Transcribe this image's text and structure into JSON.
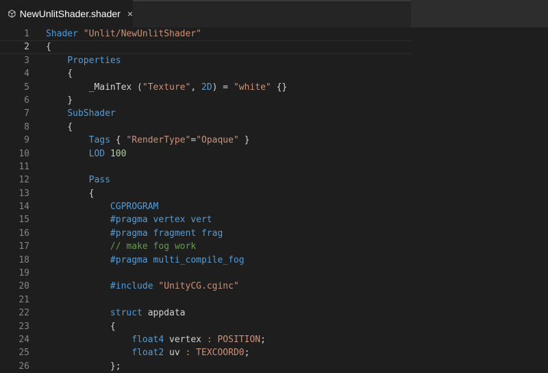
{
  "tab": {
    "title": "NewUnlitShader.shader",
    "close": "×",
    "icon": "unity-icon"
  },
  "editor": {
    "active_line": 2,
    "lines": [
      {
        "n": "1",
        "t": [
          {
            "c": "kw",
            "s": "Shader "
          },
          {
            "c": "str",
            "s": "\"Unlit/NewUnlitShader\""
          }
        ]
      },
      {
        "n": "2",
        "t": [
          {
            "c": "pl",
            "s": "{"
          }
        ]
      },
      {
        "n": "3",
        "t": [
          {
            "c": "pl",
            "s": "    "
          },
          {
            "c": "kw",
            "s": "Properties"
          }
        ]
      },
      {
        "n": "4",
        "t": [
          {
            "c": "pl",
            "s": "    {"
          }
        ]
      },
      {
        "n": "5",
        "t": [
          {
            "c": "pl",
            "s": "        _MainTex ("
          },
          {
            "c": "str",
            "s": "\"Texture\""
          },
          {
            "c": "pl",
            "s": ", "
          },
          {
            "c": "kw",
            "s": "2D"
          },
          {
            "c": "pl",
            "s": ") = "
          },
          {
            "c": "str",
            "s": "\"white\""
          },
          {
            "c": "pl",
            "s": " {}"
          }
        ]
      },
      {
        "n": "6",
        "t": [
          {
            "c": "pl",
            "s": "    }"
          }
        ]
      },
      {
        "n": "7",
        "t": [
          {
            "c": "pl",
            "s": "    "
          },
          {
            "c": "kw",
            "s": "SubShader"
          }
        ]
      },
      {
        "n": "8",
        "t": [
          {
            "c": "pl",
            "s": "    {"
          }
        ]
      },
      {
        "n": "9",
        "t": [
          {
            "c": "pl",
            "s": "        "
          },
          {
            "c": "kw",
            "s": "Tags"
          },
          {
            "c": "pl",
            "s": " { "
          },
          {
            "c": "str",
            "s": "\"RenderType\""
          },
          {
            "c": "pl",
            "s": "="
          },
          {
            "c": "str",
            "s": "\"Opaque\""
          },
          {
            "c": "pl",
            "s": " }"
          }
        ]
      },
      {
        "n": "10",
        "t": [
          {
            "c": "pl",
            "s": "        "
          },
          {
            "c": "kw",
            "s": "LOD"
          },
          {
            "c": "pl",
            "s": " "
          },
          {
            "c": "num",
            "s": "100"
          }
        ]
      },
      {
        "n": "11",
        "t": [
          {
            "c": "pl",
            "s": ""
          }
        ]
      },
      {
        "n": "12",
        "t": [
          {
            "c": "pl",
            "s": "        "
          },
          {
            "c": "kw",
            "s": "Pass"
          }
        ]
      },
      {
        "n": "13",
        "t": [
          {
            "c": "pl",
            "s": "        {"
          }
        ]
      },
      {
        "n": "14",
        "t": [
          {
            "c": "pl",
            "s": "            "
          },
          {
            "c": "kw",
            "s": "CGPROGRAM"
          }
        ]
      },
      {
        "n": "15",
        "t": [
          {
            "c": "pl",
            "s": "            "
          },
          {
            "c": "kw",
            "s": "#pragma vertex vert"
          }
        ]
      },
      {
        "n": "16",
        "t": [
          {
            "c": "pl",
            "s": "            "
          },
          {
            "c": "kw",
            "s": "#pragma fragment frag"
          }
        ]
      },
      {
        "n": "17",
        "t": [
          {
            "c": "pl",
            "s": "            "
          },
          {
            "c": "cmt",
            "s": "// make fog work"
          }
        ]
      },
      {
        "n": "18",
        "t": [
          {
            "c": "pl",
            "s": "            "
          },
          {
            "c": "kw",
            "s": "#pragma multi_compile_fog"
          }
        ]
      },
      {
        "n": "19",
        "t": [
          {
            "c": "pl",
            "s": ""
          }
        ]
      },
      {
        "n": "20",
        "t": [
          {
            "c": "pl",
            "s": "            "
          },
          {
            "c": "kw",
            "s": "#include "
          },
          {
            "c": "str",
            "s": "\"UnityCG.cginc\""
          }
        ]
      },
      {
        "n": "21",
        "t": [
          {
            "c": "pl",
            "s": ""
          }
        ]
      },
      {
        "n": "22",
        "t": [
          {
            "c": "pl",
            "s": "            "
          },
          {
            "c": "kw",
            "s": "struct"
          },
          {
            "c": "pl",
            "s": " appdata"
          }
        ]
      },
      {
        "n": "23",
        "t": [
          {
            "c": "pl",
            "s": "            {"
          }
        ]
      },
      {
        "n": "24",
        "t": [
          {
            "c": "pl",
            "s": "                "
          },
          {
            "c": "kw",
            "s": "float4"
          },
          {
            "c": "pl",
            "s": " vertex "
          },
          {
            "c": "str",
            "s": ": POSITION"
          },
          {
            "c": "pl",
            "s": ";"
          }
        ]
      },
      {
        "n": "25",
        "t": [
          {
            "c": "pl",
            "s": "                "
          },
          {
            "c": "kw",
            "s": "float2"
          },
          {
            "c": "pl",
            "s": " uv "
          },
          {
            "c": "str",
            "s": ": TEXCOORD0"
          },
          {
            "c": "pl",
            "s": ";"
          }
        ]
      },
      {
        "n": "26",
        "t": [
          {
            "c": "pl",
            "s": "            };"
          }
        ]
      }
    ]
  }
}
